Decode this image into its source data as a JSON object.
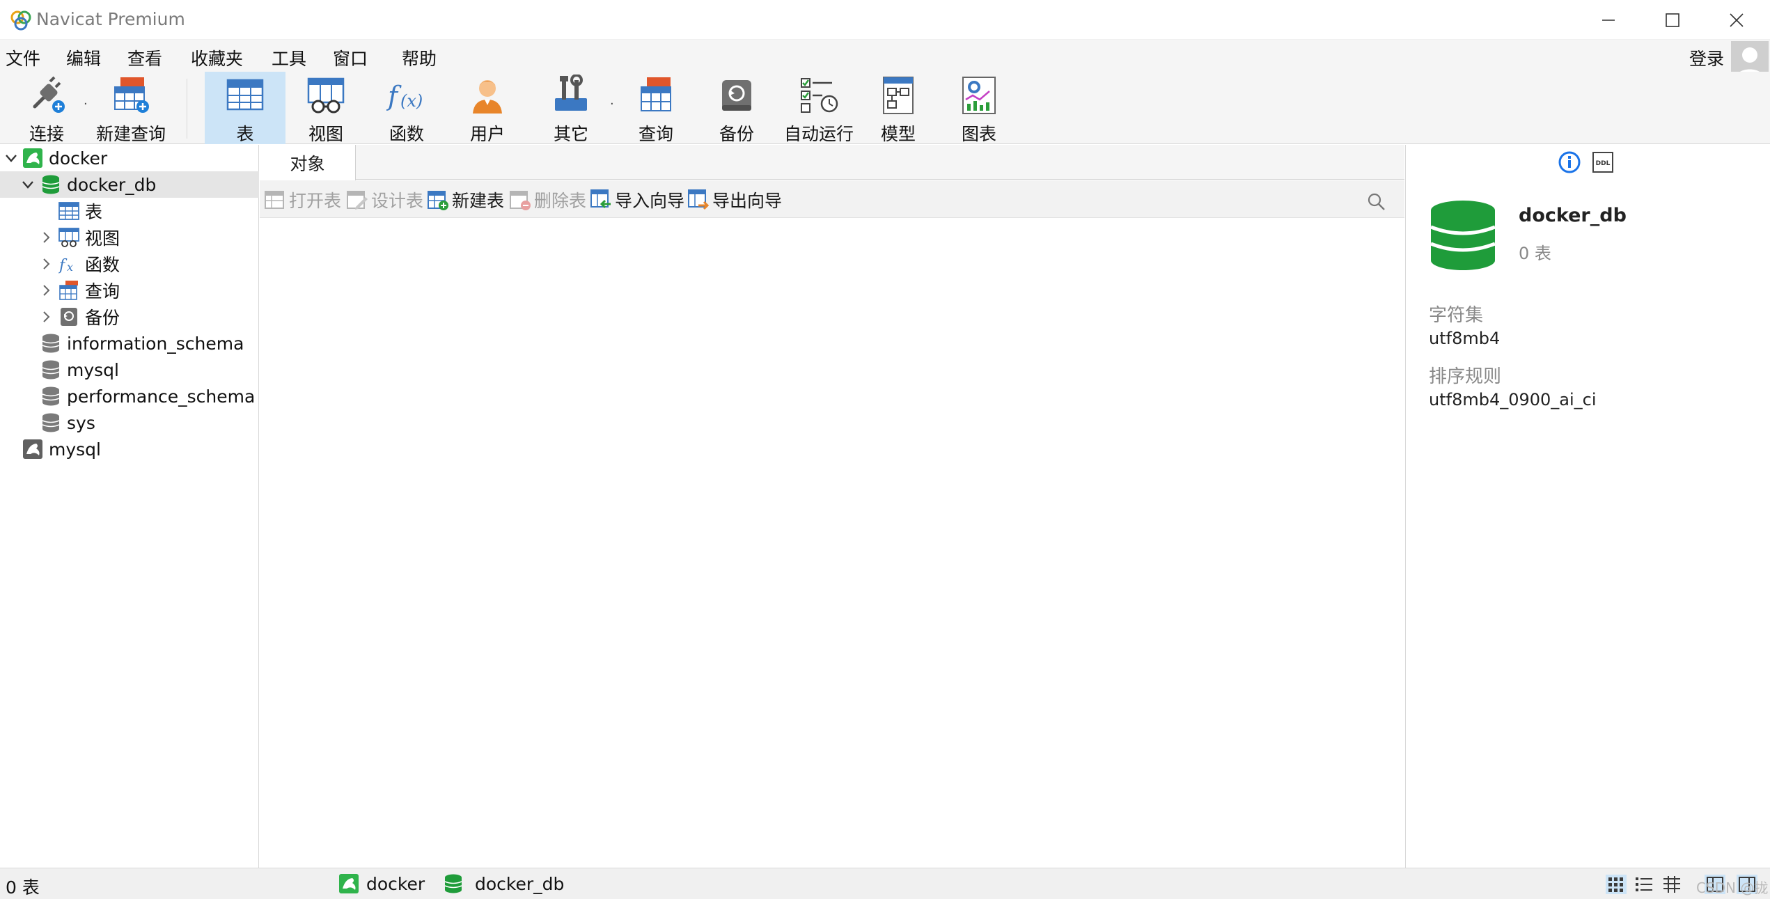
{
  "window": {
    "title": "Navicat Premium"
  },
  "menu": [
    "文件",
    "编辑",
    "查看",
    "收藏夹",
    "工具",
    "窗口",
    "帮助"
  ],
  "account": {
    "login_label": "登录"
  },
  "toolbar": {
    "connect": "连接",
    "new_query": "新建查询",
    "table": "表",
    "view": "视图",
    "function": "函数",
    "user": "用户",
    "other": "其它",
    "query": "查询",
    "backup": "备份",
    "auto_run": "自动运行",
    "model": "模型",
    "chart": "图表"
  },
  "tree": {
    "connection": "docker",
    "database": "docker_db",
    "children": {
      "tables": "表",
      "views": "视图",
      "functions": "函数",
      "queries": "查询",
      "backups": "备份"
    },
    "other_dbs": [
      "information_schema",
      "mysql",
      "performance_schema",
      "sys"
    ],
    "second_connection": "mysql"
  },
  "object_tab": {
    "label": "对象"
  },
  "object_toolbar": {
    "open_table": "打开表",
    "design_table": "设计表",
    "new_table": "新建表",
    "delete_table": "删除表",
    "import_wizard": "导入向导",
    "export_wizard": "导出向导"
  },
  "info_panel": {
    "name": "docker_db",
    "count": "0 表",
    "charset_label": "字符集",
    "charset_value": "utf8mb4",
    "collation_label": "排序规则",
    "collation_value": "utf8mb4_0900_ai_ci",
    "ddl_badge": "DDL"
  },
  "status": {
    "count": "0 表",
    "connection": "docker",
    "database": "docker_db",
    "watermark": "CSDN @拢岚"
  },
  "colors": {
    "db_green": "#1f9c3a",
    "table_blue": "#3b78c2",
    "active_bg": "#cce4f7",
    "accent": "#1a73e8"
  }
}
